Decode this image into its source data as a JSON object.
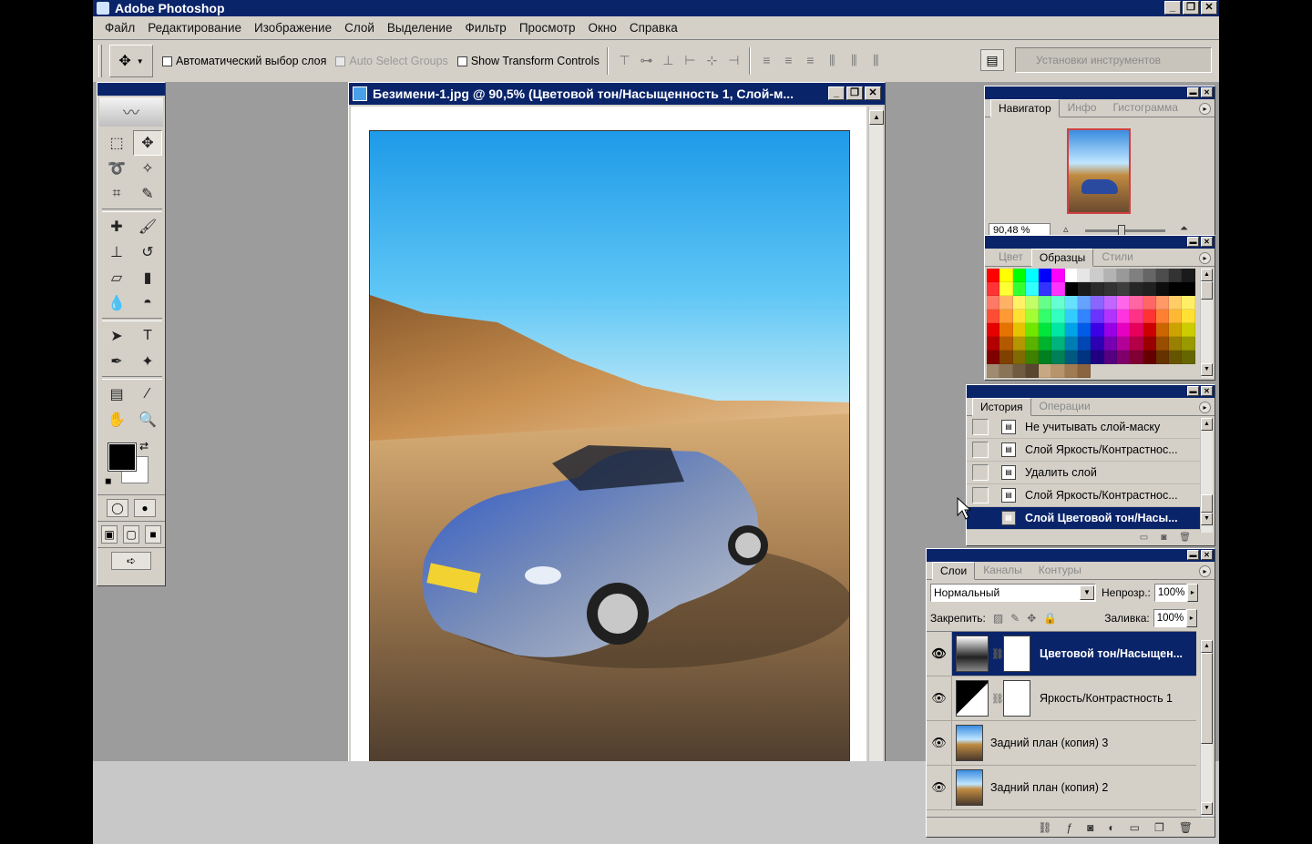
{
  "app": {
    "title": "Adobe Photoshop"
  },
  "window_buttons": [
    "_",
    "❐",
    "✕"
  ],
  "menu": [
    "Файл",
    "Редактирование",
    "Изображение",
    "Слой",
    "Выделение",
    "Фильтр",
    "Просмотр",
    "Окно",
    "Справка"
  ],
  "options": {
    "auto_select_layer": "Автоматический выбор слоя",
    "auto_select_groups": "Auto Select Groups",
    "show_transform": "Show Transform Controls",
    "tool_presets": "Установки инструментов"
  },
  "document": {
    "title": "Безимени-1.jpg @ 90,5% (Цветовой тон/Насыщенность 1, Слой-м..."
  },
  "navigator": {
    "tabs": [
      "Навигатор",
      "Инфо",
      "Гистограмма"
    ],
    "zoom": "90,48 %"
  },
  "swatches": {
    "tabs": [
      "Цвет",
      "Образцы",
      "Стили"
    ],
    "colors": [
      "#ff0000",
      "#ffff00",
      "#00ff00",
      "#00ffff",
      "#0000ff",
      "#ff00ff",
      "#ffffff",
      "#e6e6e6",
      "#cccccc",
      "#b3b3b3",
      "#999999",
      "#808080",
      "#666666",
      "#4d4d4d",
      "#333333",
      "#1a1a1a",
      "#ff3333",
      "#ffff33",
      "#33ff33",
      "#33ffff",
      "#3333ff",
      "#ff33ff",
      "#000000",
      "#1a1a1a",
      "#2a2a2a",
      "#333333",
      "#3d3d3d",
      "#262626",
      "#202020",
      "#0d0d0d",
      "#000000",
      "#000000",
      "#ff7a66",
      "#ffb266",
      "#fff066",
      "#c2ff66",
      "#66ff8a",
      "#66ffd1",
      "#66e0ff",
      "#66a3ff",
      "#8a66ff",
      "#c266ff",
      "#ff66eb",
      "#ff66a3",
      "#ff6666",
      "#ff9966",
      "#ffcc66",
      "#ffee66",
      "#ff4d33",
      "#ff9933",
      "#ffe033",
      "#a3ff33",
      "#33ff6b",
      "#33ffc2",
      "#33ccff",
      "#3385ff",
      "#6b33ff",
      "#b233ff",
      "#ff33e0",
      "#ff3385",
      "#ff3333",
      "#ff8033",
      "#ffb833",
      "#ffe033",
      "#e60000",
      "#e67300",
      "#e6c200",
      "#73e600",
      "#00e63d",
      "#00e6a3",
      "#00a3e6",
      "#005ce6",
      "#3d00e6",
      "#9900e6",
      "#e600c2",
      "#e6005c",
      "#cc0000",
      "#cc6600",
      "#cca300",
      "#cccc00",
      "#b30000",
      "#b35900",
      "#b39600",
      "#59b300",
      "#00b32d",
      "#00b37d",
      "#007db3",
      "#0047b3",
      "#2d00b3",
      "#7700b3",
      "#b30096",
      "#b30047",
      "#990000",
      "#994d00",
      "#998000",
      "#999900",
      "#800000",
      "#804000",
      "#806b00",
      "#408000",
      "#008020",
      "#008059",
      "#005980",
      "#003380",
      "#200080",
      "#550080",
      "#80006b",
      "#800033",
      "#660000",
      "#663300",
      "#665500",
      "#666600",
      "#a08a70",
      "#8a7356",
      "#705a40",
      "#5a4530",
      "#c8a882",
      "#b8946a",
      "#a07a50",
      "#8a6440"
    ]
  },
  "history": {
    "tabs": [
      "История",
      "Операции"
    ],
    "items": [
      {
        "label": "Не учитывать слой-маску"
      },
      {
        "label": "Слой Яркость/Контрастнос..."
      },
      {
        "label": "Удалить слой"
      },
      {
        "label": "Слой Яркость/Контрастнос..."
      },
      {
        "label": "Слой Цветовой тон/Насы..."
      }
    ]
  },
  "layers": {
    "tabs": [
      "Слои",
      "Каналы",
      "Контуры"
    ],
    "blend_mode": "Нормальный",
    "opacity_label": "Непрозр.:",
    "opacity": "100%",
    "lock_label": "Закрепить:",
    "fill_label": "Заливка:",
    "fill": "100%",
    "items": [
      {
        "name": "Цветовой тон/Насыщен..."
      },
      {
        "name": "Яркость/Контрастность 1"
      },
      {
        "name": "Задний план (копия) 3"
      },
      {
        "name": "Задний план (копия) 2"
      }
    ]
  },
  "icons": {
    "eye": "👁",
    "chain": "⛓",
    "move": "✥",
    "text": "T",
    "hand": "✋",
    "zoom": "🔍"
  }
}
